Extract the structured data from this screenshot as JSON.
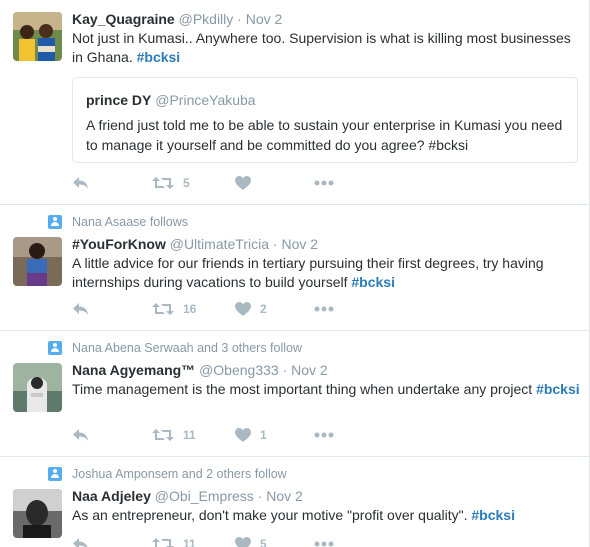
{
  "tweets": [
    {
      "context": "",
      "name": "Kay_Quagraine",
      "handle": "@Pkdilly",
      "time": "Nov 2",
      "text": "Not just in Kumasi.. Anywhere too. Supervision is what is killing most businesses in Ghana.",
      "hashtag": "#bcksi",
      "quote": {
        "name": "prince DY",
        "handle": "@PrinceYakuba",
        "text": "A friend just told me to be able to sustain your enterprise in Kumasi you need to manage it yourself and be committed do you agree? #bcksi"
      },
      "retweets": "5",
      "likes": ""
    },
    {
      "context": "Nana Asaase follows",
      "name": "#YouForKnow",
      "handle": "@UltimateTricia",
      "time": "Nov 2",
      "text": "A little advice for our friends in tertiary pursuing their first degrees, try having internships during vacations to build yourself",
      "hashtag": "#bcksi",
      "retweets": "16",
      "likes": "2"
    },
    {
      "context": "Nana Abena Serwaah and 3 others follow",
      "name": "Nana Agyemang™",
      "handle": "@Obeng333",
      "time": "Nov 2",
      "text": "Time management is the most important thing when undertake any project",
      "hashtag": "#bcksi",
      "retweets": "11",
      "likes": "1"
    },
    {
      "context": "Joshua Amponsem and 2 others follow",
      "name": "Naa Adjeley",
      "handle": "@Obi_Empress",
      "time": "Nov 2",
      "text": "As an entrepreneur, don't make your motive \"profit over quality\".",
      "hashtag": "#bcksi",
      "retweets": "11",
      "likes": "5"
    }
  ],
  "separator": "·",
  "colors": {
    "hashtag": "#2b7bb9",
    "muted": "#8899a6",
    "icon": "#aab8c2",
    "border": "#e1e8ed"
  },
  "icons": [
    "reply-icon",
    "retweet-icon",
    "like-icon",
    "more-icon",
    "follow-context-icon"
  ]
}
